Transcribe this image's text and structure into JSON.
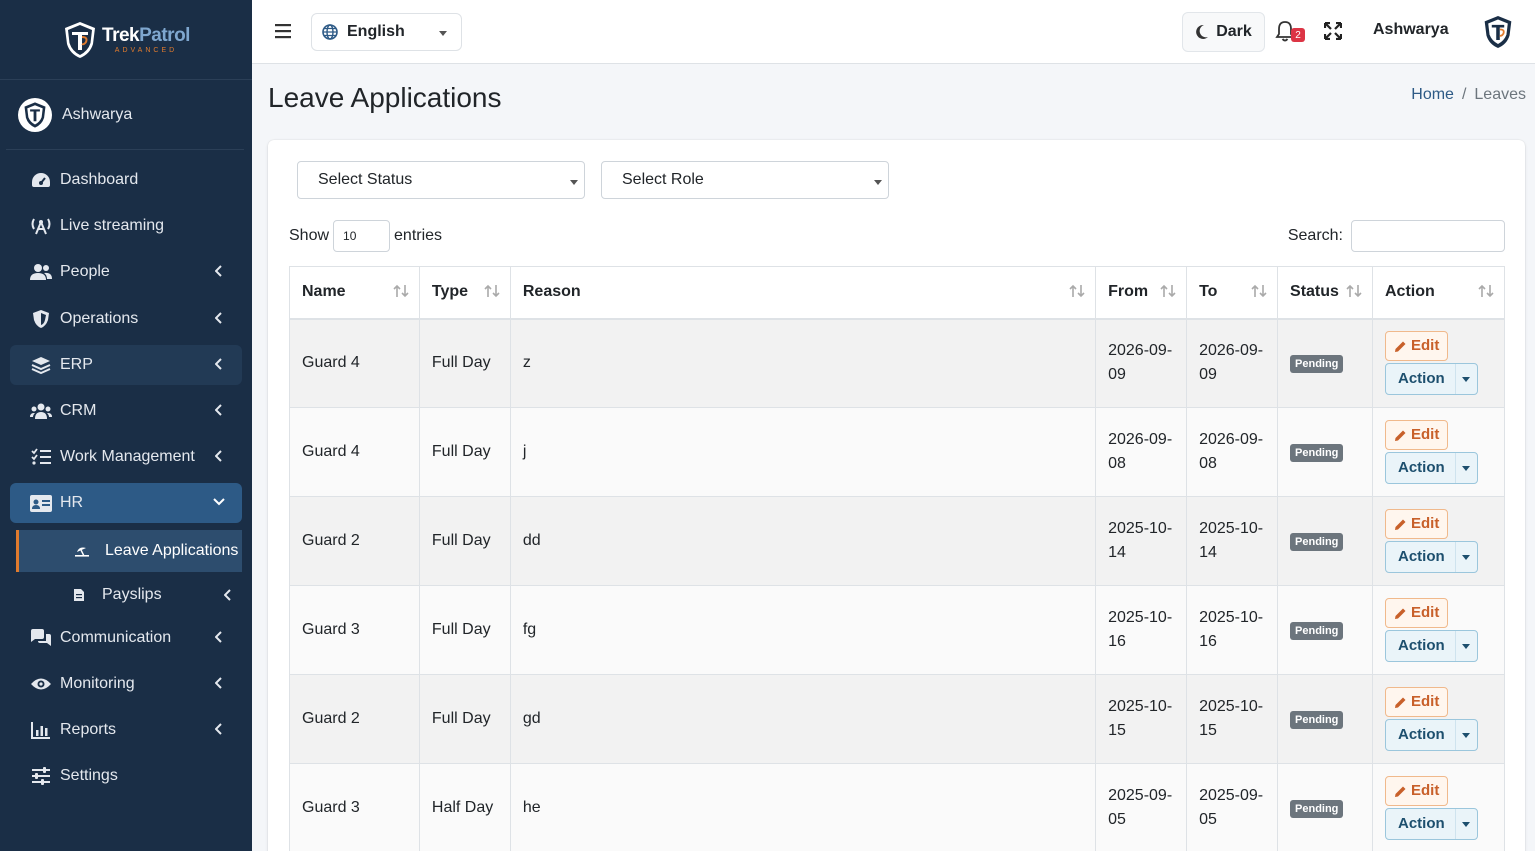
{
  "brand": {
    "name_part1": "Trek",
    "name_part2": "Patrol",
    "tagline": "ADVANCED"
  },
  "user": {
    "name": "Ashwarya"
  },
  "sidebar": {
    "items": [
      {
        "label": "Dashboard"
      },
      {
        "label": "Live streaming"
      },
      {
        "label": "People"
      },
      {
        "label": "Operations"
      },
      {
        "label": "ERP"
      },
      {
        "label": "CRM"
      },
      {
        "label": "Work Management"
      },
      {
        "label": "HR"
      },
      {
        "label": "Communication"
      },
      {
        "label": "Monitoring"
      },
      {
        "label": "Reports"
      },
      {
        "label": "Settings"
      }
    ],
    "hr_sub": [
      {
        "label": "Leave Applications"
      },
      {
        "label": "Payslips"
      }
    ]
  },
  "topbar": {
    "language": "English",
    "theme_label": "Dark",
    "notification_count": "2",
    "user_name": "Ashwarya"
  },
  "page": {
    "title": "Leave Applications",
    "breadcrumb": {
      "home": "Home",
      "separator": "/",
      "current": "Leaves"
    }
  },
  "filters": {
    "status_placeholder": "Select Status",
    "role_placeholder": "Select Role"
  },
  "table_controls": {
    "show_label": "Show",
    "entries_value": "10",
    "entries_label": "entries",
    "search_label": "Search:"
  },
  "table": {
    "headers": [
      "Name",
      "Type",
      "Reason",
      "From",
      "To",
      "Status",
      "Action"
    ],
    "edit_label": "Edit",
    "action_label": "Action",
    "rows": [
      {
        "name": "Guard 4",
        "type": "Full Day",
        "reason": "z",
        "from": "2026-09-\n09",
        "to": "2026-09-\n09",
        "status": "Pending"
      },
      {
        "name": "Guard 4",
        "type": "Full Day",
        "reason": "j",
        "from": "2026-09-\n08",
        "to": "2026-09-\n08",
        "status": "Pending"
      },
      {
        "name": "Guard 2",
        "type": "Full Day",
        "reason": "dd",
        "from": "2025-10-\n14",
        "to": "2025-10-\n14",
        "status": "Pending"
      },
      {
        "name": "Guard 3",
        "type": "Full Day",
        "reason": "fg",
        "from": "2025-10-\n16",
        "to": "2025-10-\n16",
        "status": "Pending"
      },
      {
        "name": "Guard 2",
        "type": "Full Day",
        "reason": "gd",
        "from": "2025-10-\n15",
        "to": "2025-10-\n15",
        "status": "Pending"
      },
      {
        "name": "Guard 3",
        "type": "Half Day",
        "reason": "he",
        "from": "2025-09-\n05",
        "to": "2025-09-\n05",
        "status": "Pending"
      }
    ]
  },
  "colors": {
    "sidebar_bg": "#1a2e46",
    "hr_active_bg": "#2d5a86",
    "accent_orange": "#e07b2e",
    "badge_gray": "#6c757d"
  }
}
